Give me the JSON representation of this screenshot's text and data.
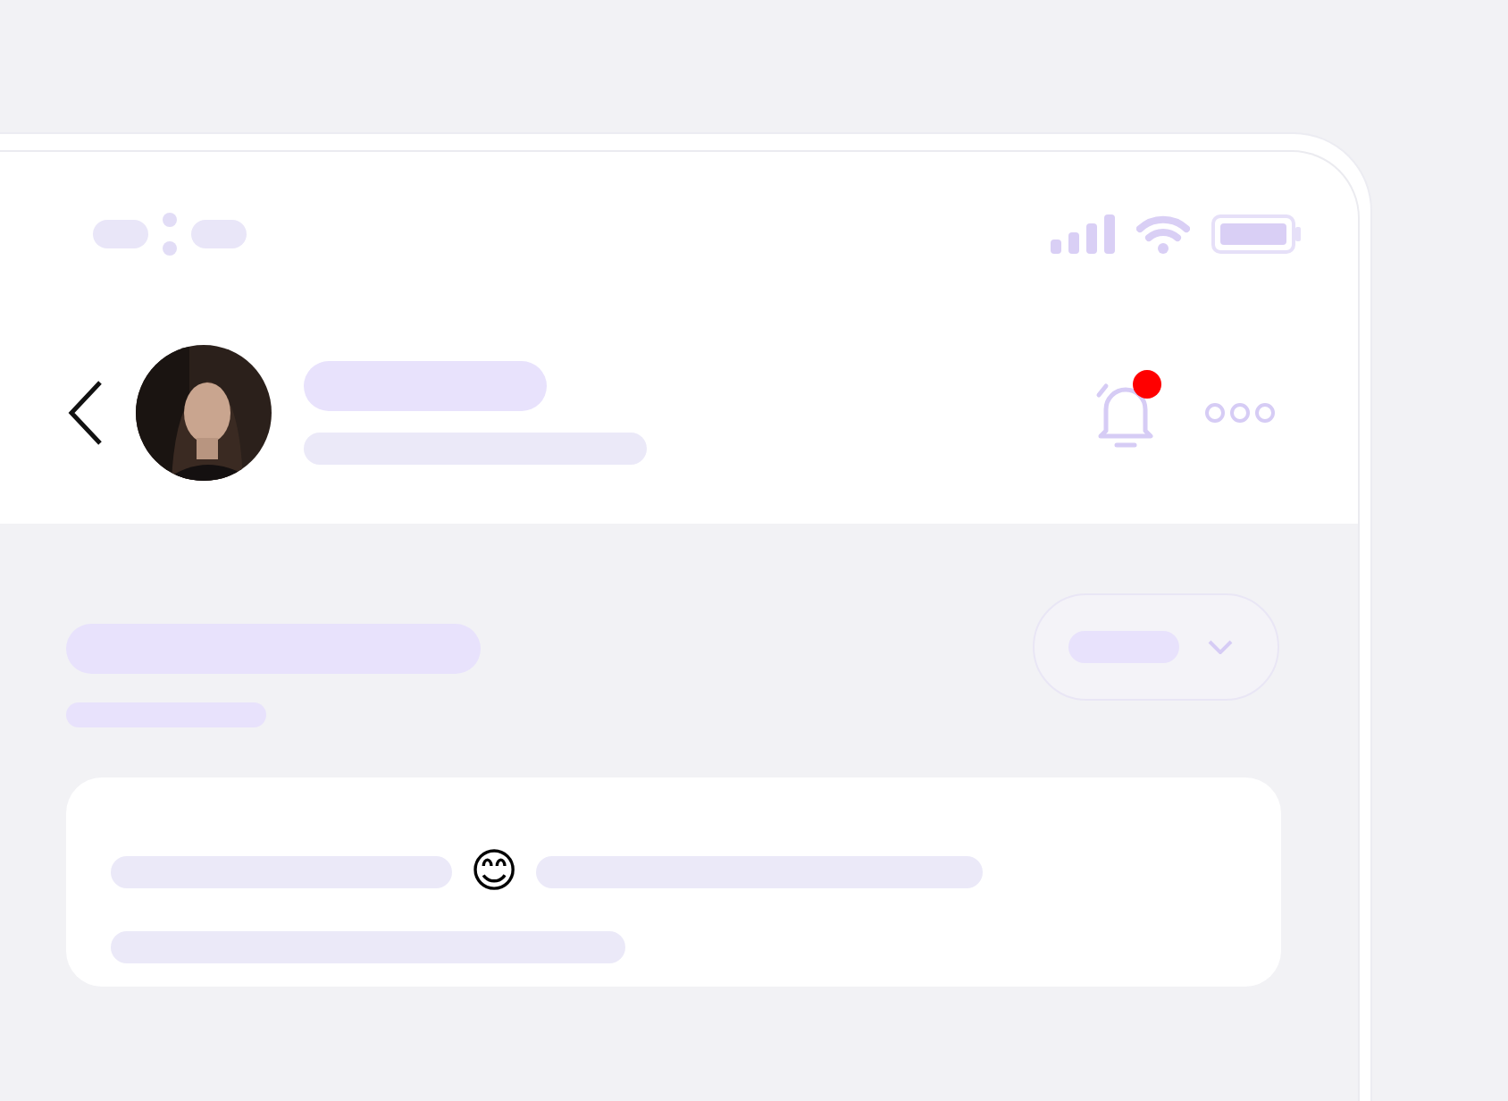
{
  "notification": {
    "unread": true
  },
  "filter": {
    "expanded": false
  },
  "message": {
    "emoji": "😊"
  }
}
